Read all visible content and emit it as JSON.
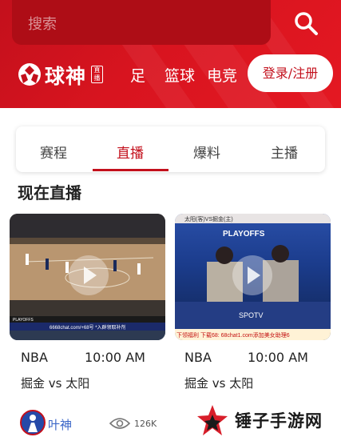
{
  "search": {
    "placeholder": "搜索",
    "icon": "search-icon"
  },
  "brand": {
    "logo_text": "球神",
    "logo_tag": "直播",
    "color": "#c3101c"
  },
  "topnav": [
    {
      "label": "足"
    },
    {
      "label": "篮球"
    },
    {
      "label": "电竞"
    }
  ],
  "login_label": "登录/注册",
  "tabs": [
    {
      "label": "赛程",
      "active": false
    },
    {
      "label": "直播",
      "active": true
    },
    {
      "label": "爆料",
      "active": false
    },
    {
      "label": "主播",
      "active": false
    }
  ],
  "section_title": "现在直播",
  "live_cards": [
    {
      "league": "NBA",
      "time": "10:00 AM",
      "matchup": "掘金 vs 太阳",
      "overlay_text": "6668chat.com/+68号 *入群领取补剂",
      "score_brand": "PLAYOFFS"
    },
    {
      "league": "NBA",
      "time": "10:00 AM",
      "matchup": "掘金 vs 太阳",
      "overlay_text": "下领福利 下载68: 68chat1.com添加美女助理6",
      "score_brand": "PLAYOFFS",
      "top_text": "太阳(客)VS掘金(主)",
      "desk_text": "SPOTV"
    }
  ],
  "author": {
    "name": "叶神",
    "views": "126K"
  },
  "watermark": {
    "text": "锤子手游网"
  }
}
